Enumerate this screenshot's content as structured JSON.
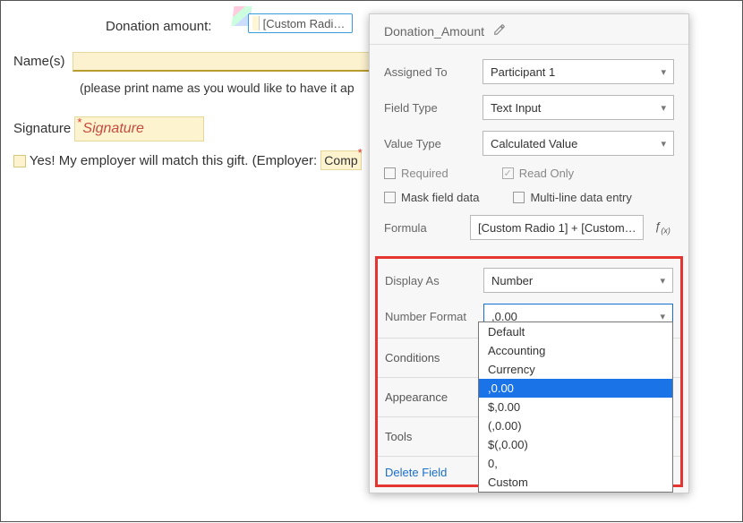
{
  "form": {
    "donation_label": "Donation amount:",
    "chip_label": "[Custom Radi…",
    "name_label": "Name(s)",
    "print_note": "(please print name as you would like to have it ap",
    "signature_label": "Signature",
    "signature_field_text": "Signature",
    "yes_line_pre": "Yes!  My employer will match this gift.  (Employer:",
    "company_field_text": "Comp"
  },
  "panel": {
    "title": "Donation_Amount",
    "assigned_to_label": "Assigned To",
    "assigned_to_value": "Participant 1",
    "field_type_label": "Field Type",
    "field_type_value": "Text Input",
    "value_type_label": "Value Type",
    "value_type_value": "Calculated Value",
    "required_label": "Required",
    "readonly_label": "Read Only",
    "mask_label": "Mask field data",
    "multiline_label": "Multi-line data entry",
    "formula_label": "Formula",
    "formula_value": "[Custom Radio 1] + [Custom…",
    "display_as_label": "Display As",
    "display_as_value": "Number",
    "number_format_label": "Number Format",
    "number_format_value": ",0.00",
    "conditions_label": "Conditions",
    "appearance_label": "Appearance",
    "tools_label": "Tools",
    "delete_label": "Delete Field",
    "number_format_options": [
      "Default",
      "Accounting",
      "Currency",
      ",0.00",
      "$,0.00",
      "(,0.00)",
      "$(,0.00)",
      "0,",
      "Custom"
    ],
    "number_format_selected_index": 3
  }
}
